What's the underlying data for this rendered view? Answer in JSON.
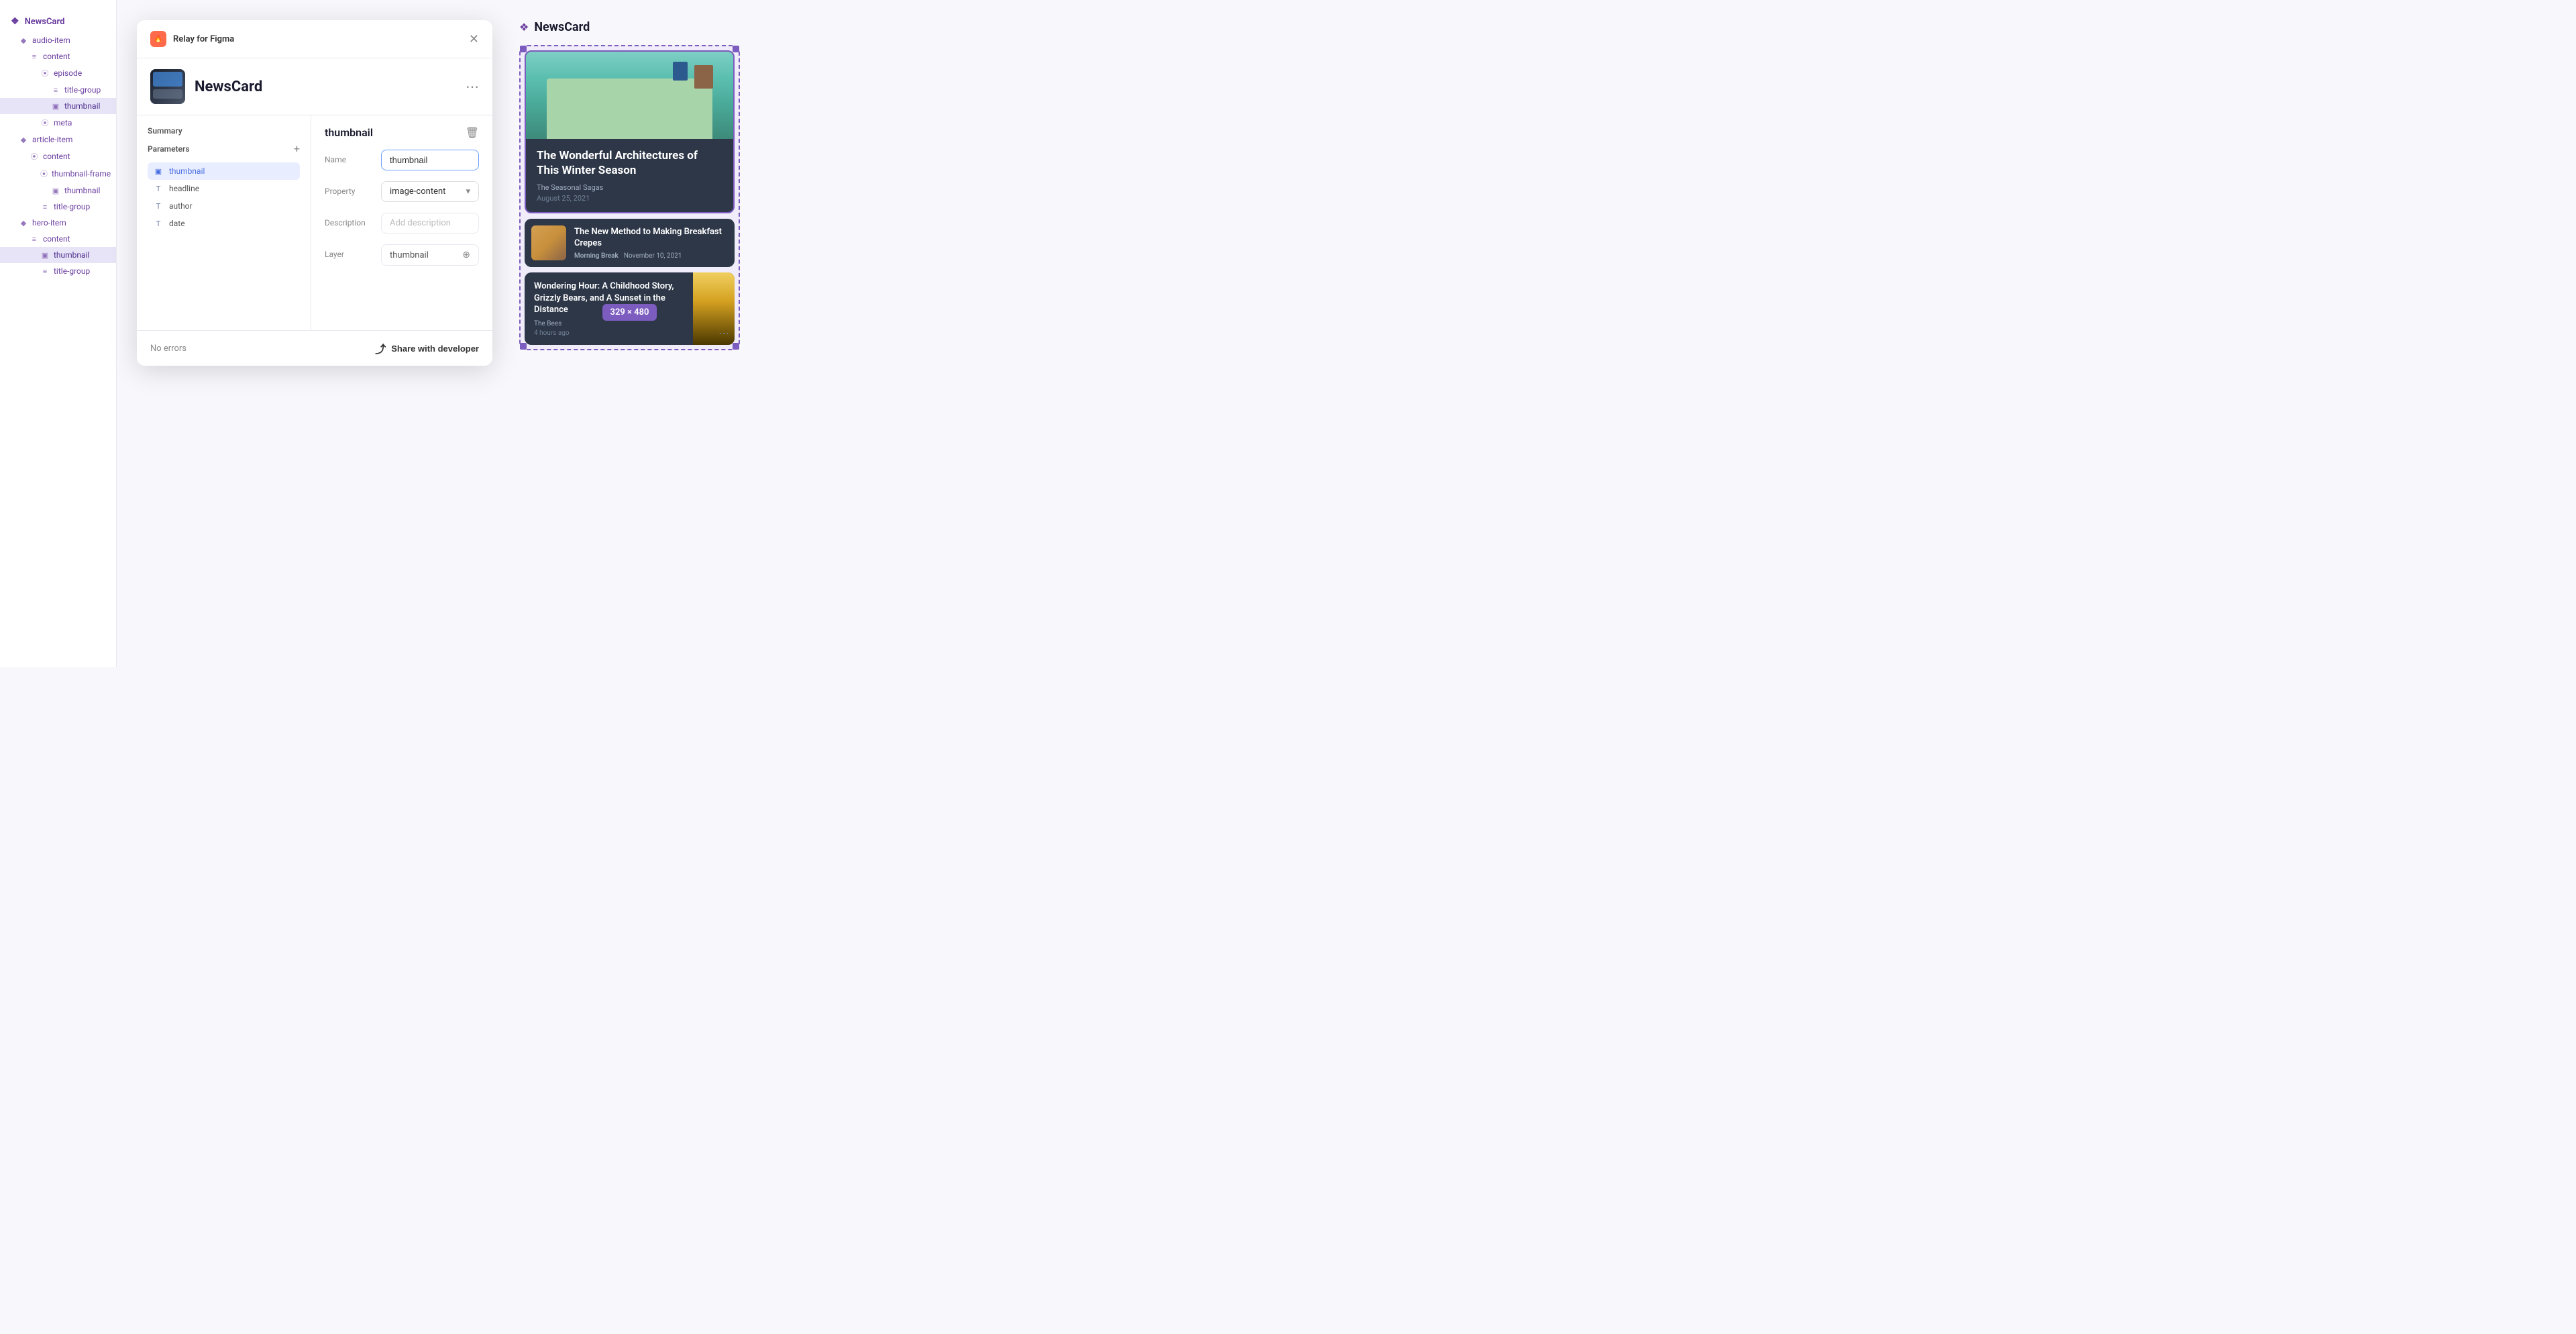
{
  "sidebar": {
    "root_label": "NewsCard",
    "items": [
      {
        "id": "audio-item",
        "label": "audio-item",
        "indent": 0,
        "icon": "◆",
        "icon_type": "diamond"
      },
      {
        "id": "content",
        "label": "content",
        "indent": 1,
        "icon": "≡",
        "icon_type": "lines"
      },
      {
        "id": "episode",
        "label": "episode",
        "indent": 2,
        "icon": "|||",
        "icon_type": "bars"
      },
      {
        "id": "title-group",
        "label": "title-group",
        "indent": 3,
        "icon": "≡",
        "icon_type": "lines"
      },
      {
        "id": "thumbnail",
        "label": "thumbnail",
        "indent": 3,
        "icon": "▣",
        "icon_type": "image",
        "active": true
      },
      {
        "id": "meta",
        "label": "meta",
        "indent": 2,
        "icon": "|||",
        "icon_type": "bars"
      },
      {
        "id": "article-item",
        "label": "article-item",
        "indent": 0,
        "icon": "◆",
        "icon_type": "diamond"
      },
      {
        "id": "content2",
        "label": "content",
        "indent": 1,
        "icon": "|||",
        "icon_type": "bars"
      },
      {
        "id": "thumbnail-frame",
        "label": "thumbnail-frame",
        "indent": 2,
        "icon": "|||",
        "icon_type": "bars"
      },
      {
        "id": "thumbnail2",
        "label": "thumbnail",
        "indent": 3,
        "icon": "▣",
        "icon_type": "image"
      },
      {
        "id": "title-group2",
        "label": "title-group",
        "indent": 2,
        "icon": "≡",
        "icon_type": "lines"
      },
      {
        "id": "hero-item",
        "label": "hero-item",
        "indent": 0,
        "icon": "◆",
        "icon_type": "diamond"
      },
      {
        "id": "content3",
        "label": "content",
        "indent": 1,
        "icon": "≡",
        "icon_type": "lines"
      },
      {
        "id": "thumbnail3",
        "label": "thumbnail",
        "indent": 2,
        "icon": "▣",
        "icon_type": "image",
        "active": true
      },
      {
        "id": "title-group3",
        "label": "title-group",
        "indent": 2,
        "icon": "≡",
        "icon_type": "lines"
      }
    ]
  },
  "dialog": {
    "app_name": "Relay for Figma",
    "component_name": "NewsCard",
    "summary_label": "Summary",
    "parameters_label": "Parameters",
    "params": [
      {
        "id": "thumbnail",
        "label": "thumbnail",
        "icon": "▣",
        "active": true
      },
      {
        "id": "headline",
        "label": "headline",
        "icon": "T"
      },
      {
        "id": "author",
        "label": "author",
        "icon": "T"
      },
      {
        "id": "date",
        "label": "date",
        "icon": "T"
      }
    ],
    "right_panel": {
      "title": "thumbnail",
      "name_label": "Name",
      "name_value": "thumbnail",
      "property_label": "Property",
      "property_value": "image-content",
      "description_label": "Description",
      "description_placeholder": "Add description",
      "layer_label": "Layer",
      "layer_value": "thumbnail"
    },
    "footer": {
      "no_errors": "No errors",
      "share_label": "Share with developer"
    }
  },
  "preview": {
    "title": "NewsCard",
    "hero": {
      "title": "The Wonderful Architectures of This Winter Season",
      "author": "The Seasonal Sagas",
      "date": "August 25, 2021"
    },
    "card2": {
      "title": "The New Method to Making Breakfast Crepes",
      "source": "Morning Break",
      "date": "November 10, 2021"
    },
    "card3": {
      "title": "Wondering Hour: A Childhood Story, Grizzly Bears, and A Sunset in the Distance",
      "source": "The Bees",
      "time": "4 hours ago"
    },
    "size_badge": "329 × 480"
  }
}
